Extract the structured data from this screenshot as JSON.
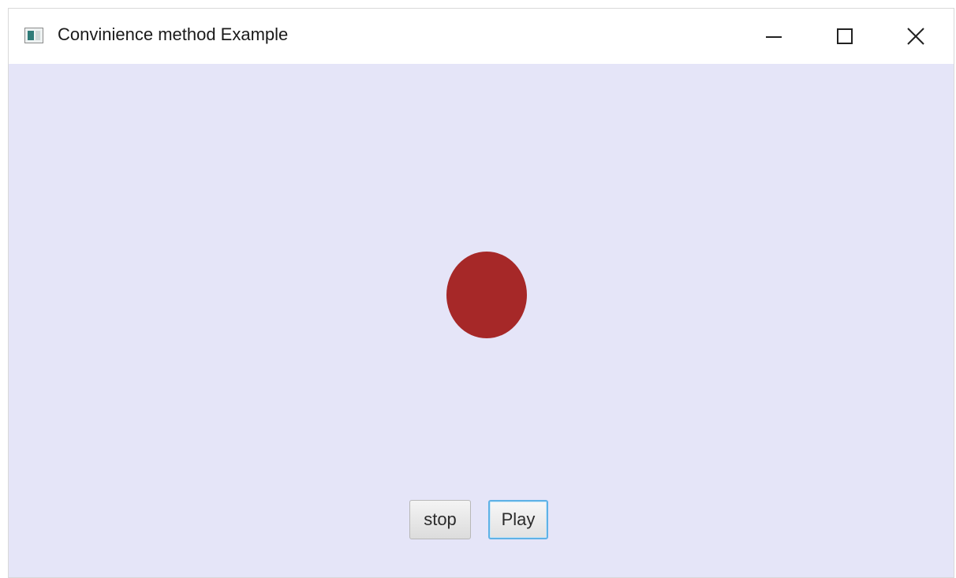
{
  "window": {
    "title": "Convinience method Example"
  },
  "icons": {
    "app": "window-app-icon",
    "minimize": "minimize-icon",
    "maximize": "maximize-icon",
    "close": "close-icon"
  },
  "controls": {
    "stop_label": "stop",
    "play_label": "Play"
  },
  "colors": {
    "background": "#e5e5f8",
    "ball": "#a62828",
    "focus_border": "#5fb2e6"
  }
}
